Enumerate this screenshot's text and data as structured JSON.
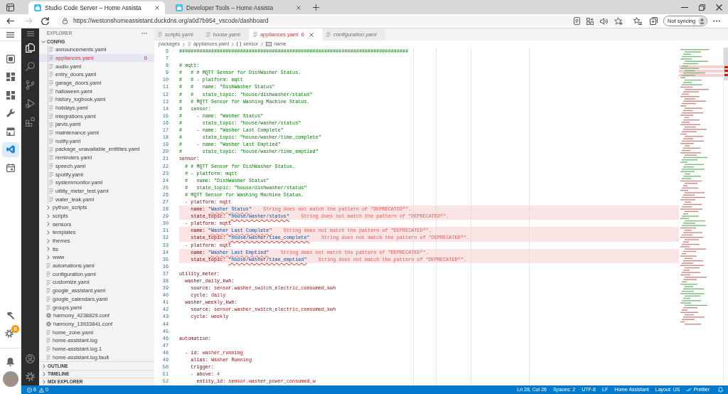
{
  "browser": {
    "tabs": [
      {
        "title": "Studio Code Server – Home Assista",
        "selected": true
      },
      {
        "title": "Developer Tools – Home Assista",
        "selected": false
      }
    ],
    "forward_disabled": true,
    "url": "https://westonshomeassistant.duckdns.org/a0d7b954_vscode/dashboard",
    "sync_button": "Not syncing"
  },
  "ha_sidebar": {
    "items": [
      {
        "selected": false
      },
      {
        "selected": false
      },
      {
        "selected": false
      },
      {
        "selected": false
      },
      {
        "selected": false
      },
      {
        "selected": true
      },
      {
        "selected": false
      }
    ],
    "settings_badge": "8"
  },
  "activity_bar": {
    "views": [
      {
        "selected": true
      },
      {
        "selected": false
      },
      {
        "selected": false
      },
      {
        "selected": false
      },
      {
        "selected": false
      }
    ]
  },
  "explorer": {
    "title": "EXPLORER",
    "root": {
      "label": "CONFIG",
      "expanded": true,
      "children": [
        {
          "kind": "folder",
          "expanded": true,
          "children": [
            {
              "kind": "file",
              "label": "announcements.yaml",
              "selected": false
            },
            {
              "kind": "file",
              "label": "appliances.yaml",
              "selected": true,
              "problems": "6"
            },
            {
              "kind": "file",
              "label": "audio.yaml",
              "selected": false
            },
            {
              "kind": "file",
              "label": "entry_doors.yaml",
              "selected": false
            },
            {
              "kind": "file",
              "label": "garage_doors.yaml",
              "selected": false
            },
            {
              "kind": "file",
              "label": "halloween.yaml",
              "selected": false
            },
            {
              "kind": "file",
              "label": "history_logbook.yaml",
              "selected": false
            },
            {
              "kind": "file",
              "label": "holidays.yaml",
              "selected": false
            },
            {
              "kind": "file",
              "label": "integrations.yaml",
              "selected": false
            },
            {
              "kind": "file",
              "label": "jarvis.yaml",
              "selected": false
            },
            {
              "kind": "file",
              "label": "maintenance.yaml",
              "selected": false
            },
            {
              "kind": "file",
              "label": "notify.yaml",
              "selected": false
            },
            {
              "kind": "file",
              "label": "package_unavailable_entitites.yaml",
              "selected": false
            },
            {
              "kind": "file",
              "label": "reminders.yaml",
              "selected": false
            },
            {
              "kind": "file",
              "label": "speech.yaml",
              "selected": false
            },
            {
              "kind": "file",
              "label": "spotify.yaml",
              "selected": false
            },
            {
              "kind": "file",
              "label": "systemmonitor.yaml",
              "selected": false
            },
            {
              "kind": "file",
              "label": "utility_meter_test.yaml",
              "selected": false
            },
            {
              "kind": "file",
              "label": "water_leak.yaml",
              "selected": false
            }
          ]
        },
        {
          "kind": "folder",
          "label": "python_scripts",
          "expanded": false,
          "selected": false
        },
        {
          "kind": "folder",
          "label": "scripts",
          "expanded": false,
          "selected": false
        },
        {
          "kind": "folder",
          "label": "sensors",
          "expanded": false,
          "selected": false
        },
        {
          "kind": "folder",
          "label": "templates",
          "expanded": false,
          "selected": false
        },
        {
          "kind": "folder",
          "label": "themes",
          "expanded": false,
          "selected": false
        },
        {
          "kind": "folder",
          "label": "tts",
          "expanded": false,
          "selected": false
        },
        {
          "kind": "folder",
          "label": "www",
          "expanded": false,
          "selected": false
        },
        {
          "kind": "file",
          "label": "automations.yaml",
          "selected": false
        },
        {
          "kind": "file",
          "label": "configuration.yaml",
          "selected": false
        },
        {
          "kind": "file",
          "label": "customize.yaml",
          "selected": false
        },
        {
          "kind": "file",
          "label": "google_assistant.yaml",
          "selected": false
        },
        {
          "kind": "file",
          "label": "google_calendars.yaml",
          "selected": false
        },
        {
          "kind": "file",
          "label": "groups.yaml",
          "selected": false
        },
        {
          "kind": "conf",
          "label": "harmony_4238829.conf",
          "selected": false
        },
        {
          "kind": "conf",
          "label": "harmony_13933841.conf",
          "selected": false
        },
        {
          "kind": "file",
          "label": "home_zone.yaml",
          "selected": false
        },
        {
          "kind": "file",
          "label": "home-assistant.log",
          "selected": false
        },
        {
          "kind": "file",
          "label": "home-assistant.log.1",
          "selected": false
        },
        {
          "kind": "file",
          "label": "home-assistant.log.fault",
          "selected": false
        }
      ]
    },
    "panels": [
      {
        "label": "OUTLINE",
        "expanded": false
      },
      {
        "label": "TIMELINE",
        "expanded": false
      },
      {
        "label": "MDI EXPLORER",
        "expanded": false
      }
    ]
  },
  "editor": {
    "tabs": [
      {
        "label": "scripts.yaml",
        "selected": false,
        "preview": false
      },
      {
        "label": "house.yaml",
        "selected": false,
        "preview": false
      },
      {
        "label": "appliances.yaml",
        "problems": "6",
        "selected": true,
        "preview": false
      },
      {
        "label": "configuration.yaml",
        "selected": false,
        "preview": true
      }
    ],
    "breadcrumb": [
      {
        "kind": "folder",
        "label": "packages"
      },
      {
        "kind": "file",
        "label": "appliances.yaml"
      },
      {
        "kind": "array",
        "label": "sensor"
      },
      {
        "kind": "field",
        "label": "name"
      }
    ],
    "lines": [
      {
        "n": "6",
        "comment": "###############################################################################"
      },
      {
        "n": "7"
      },
      {
        "n": "8",
        "comment": "# mqtt:"
      },
      {
        "n": "9",
        "comment": "#   # # MQTT Sensor for DishWasher Status."
      },
      {
        "n": "10",
        "comment": "#   # - platform: mqtt"
      },
      {
        "n": "11",
        "comment": "#   #   name: \"DishWasher Status\""
      },
      {
        "n": "12",
        "comment": "#   #   state_topic: \"house/dishwasher/status\""
      },
      {
        "n": "13",
        "comment": "#   # MQTT Sensor for Washing Machine Status."
      },
      {
        "n": "14",
        "comment": "#   sensor:"
      },
      {
        "n": "15",
        "comment": "#     - name: \"Washer Status\""
      },
      {
        "n": "16",
        "comment": "#       state_topic: \"house/washer/status\""
      },
      {
        "n": "17",
        "comment": "#     - name: \"Washer Last Complete\""
      },
      {
        "n": "18",
        "comment": "#       state_topic: \"house/washer/time_complete\""
      },
      {
        "n": "19",
        "comment": "#     - name: \"Washer Last Emptied\""
      },
      {
        "n": "20",
        "comment": "#       state_topic: \"house/washer/time_emptied\""
      },
      {
        "n": "21",
        "key": "sensor:"
      },
      {
        "n": "22",
        "comment": "  # # MQTT Sensor for DishWasher Status."
      },
      {
        "n": "23",
        "comment": "  # - platform: mqtt"
      },
      {
        "n": "24",
        "comment": "  #   name: \"DishWasher Status\""
      },
      {
        "n": "25",
        "comment": "  #   state_topic: \"house/dishwasher/status\""
      },
      {
        "n": "26",
        "comment": "  # MQTT Sensor for Washing Machine Status."
      },
      {
        "n": "27",
        "key": "  - platform:",
        "value": "mqtt"
      },
      {
        "n": "28",
        "key": "    name:",
        "string": "\"Washer Status\"",
        "error": "String does not match the pattern of \"DEPRECATED^\"."
      },
      {
        "n": "29",
        "key": "    state_topic:",
        "string": "\"house/washer/status\"",
        "error": "String does not match the pattern of \"DEPRECATED^\"."
      },
      {
        "n": "30",
        "key": "  - platform:",
        "value": "mqtt"
      },
      {
        "n": "31",
        "key": "    name:",
        "string": "\"Washer Last Complete\"",
        "error": "String does not match the pattern of \"DEPRECATED^\"."
      },
      {
        "n": "32",
        "key": "    state_topic:",
        "string": "\"house/washer/time_complete\"",
        "error": "String does not match the pattern of \"DEPRECATED^\"."
      },
      {
        "n": "33",
        "key": "  - platform:",
        "value": "mqtt"
      },
      {
        "n": "34",
        "key": "    name:",
        "string": "\"Washer Last Emptied\"",
        "error": "String does not match the pattern of \"DEPRECATED^\"."
      },
      {
        "n": "35",
        "key": "    state_topic:",
        "string": "\"house/washer/time_emptied\"",
        "error": "String does not match the pattern of \"DEPRECATED^\"."
      },
      {
        "n": "36"
      },
      {
        "n": "37",
        "key": "utility_meter:"
      },
      {
        "n": "38",
        "key": "  washer_daily_kwh:"
      },
      {
        "n": "39",
        "key": "    source:",
        "value": "sensor.washer_switch_electric_consumed_kwh"
      },
      {
        "n": "40",
        "key": "    cycle:",
        "value": "daily"
      },
      {
        "n": "41",
        "key": "  washer_weekly_kwh:"
      },
      {
        "n": "42",
        "key": "    source:",
        "value": "sensor.washer_switch_electric_consumed_kwh"
      },
      {
        "n": "43",
        "key": "    cycle:",
        "value": "weekly"
      },
      {
        "n": "44"
      },
      {
        "n": "45"
      },
      {
        "n": "46",
        "key": "automation:"
      },
      {
        "n": "47"
      },
      {
        "n": "48",
        "key": "  - id:",
        "value": "washer_running"
      },
      {
        "n": "49",
        "key": "    alias:",
        "value": "Washer Running"
      },
      {
        "n": "50",
        "key": "    trigger:"
      },
      {
        "n": "51",
        "key": "    - above:",
        "number": "4"
      },
      {
        "n": "52",
        "key": "      entity_id:",
        "value": "sensor.washer_power_consumed_w"
      }
    ]
  },
  "status_bar": {
    "errors": "6",
    "warnings": "0",
    "items": [
      {
        "kind": "text",
        "label": "Ln 28, Col 26"
      },
      {
        "kind": "text",
        "label": "Spaces: 2"
      },
      {
        "kind": "text",
        "label": "UTF-8"
      },
      {
        "kind": "text",
        "label": "LF"
      },
      {
        "kind": "text",
        "label": "Home Assistant"
      },
      {
        "kind": "text",
        "label": "Layout: US"
      },
      {
        "kind": "check",
        "label": "Prettier"
      }
    ]
  }
}
